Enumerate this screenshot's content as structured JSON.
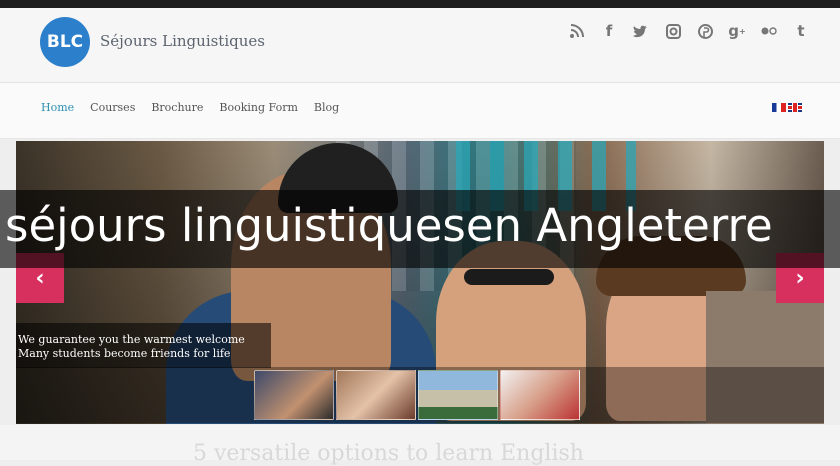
{
  "header": {
    "logo_initials": "BLC",
    "site_name": "Séjours Linguistiques",
    "social_icons": [
      "rss-icon",
      "facebook-icon",
      "twitter-icon",
      "instagram-icon",
      "pinterest-icon",
      "googleplus-icon",
      "flickr-icon",
      "tumblr-icon"
    ],
    "brand_color": "#2c7fcb"
  },
  "nav": {
    "items": [
      {
        "label": "Home",
        "active": true
      },
      {
        "label": "Courses"
      },
      {
        "label": "Brochure"
      },
      {
        "label": "Booking Form"
      },
      {
        "label": "Blog"
      }
    ],
    "languages": [
      "fr-flag-icon",
      "uk-flag-icon"
    ]
  },
  "slider": {
    "prev_icon": "‹",
    "next_icon": "›",
    "caption_lines": [
      "We guarantee you the warmest welcome",
      "Many students become friends for life"
    ],
    "accent_color": "#d8305e"
  },
  "overlay": {
    "title": "séjours linguistiquesen Angleterre"
  },
  "section": {
    "heading": "5 versatile options to learn English"
  }
}
